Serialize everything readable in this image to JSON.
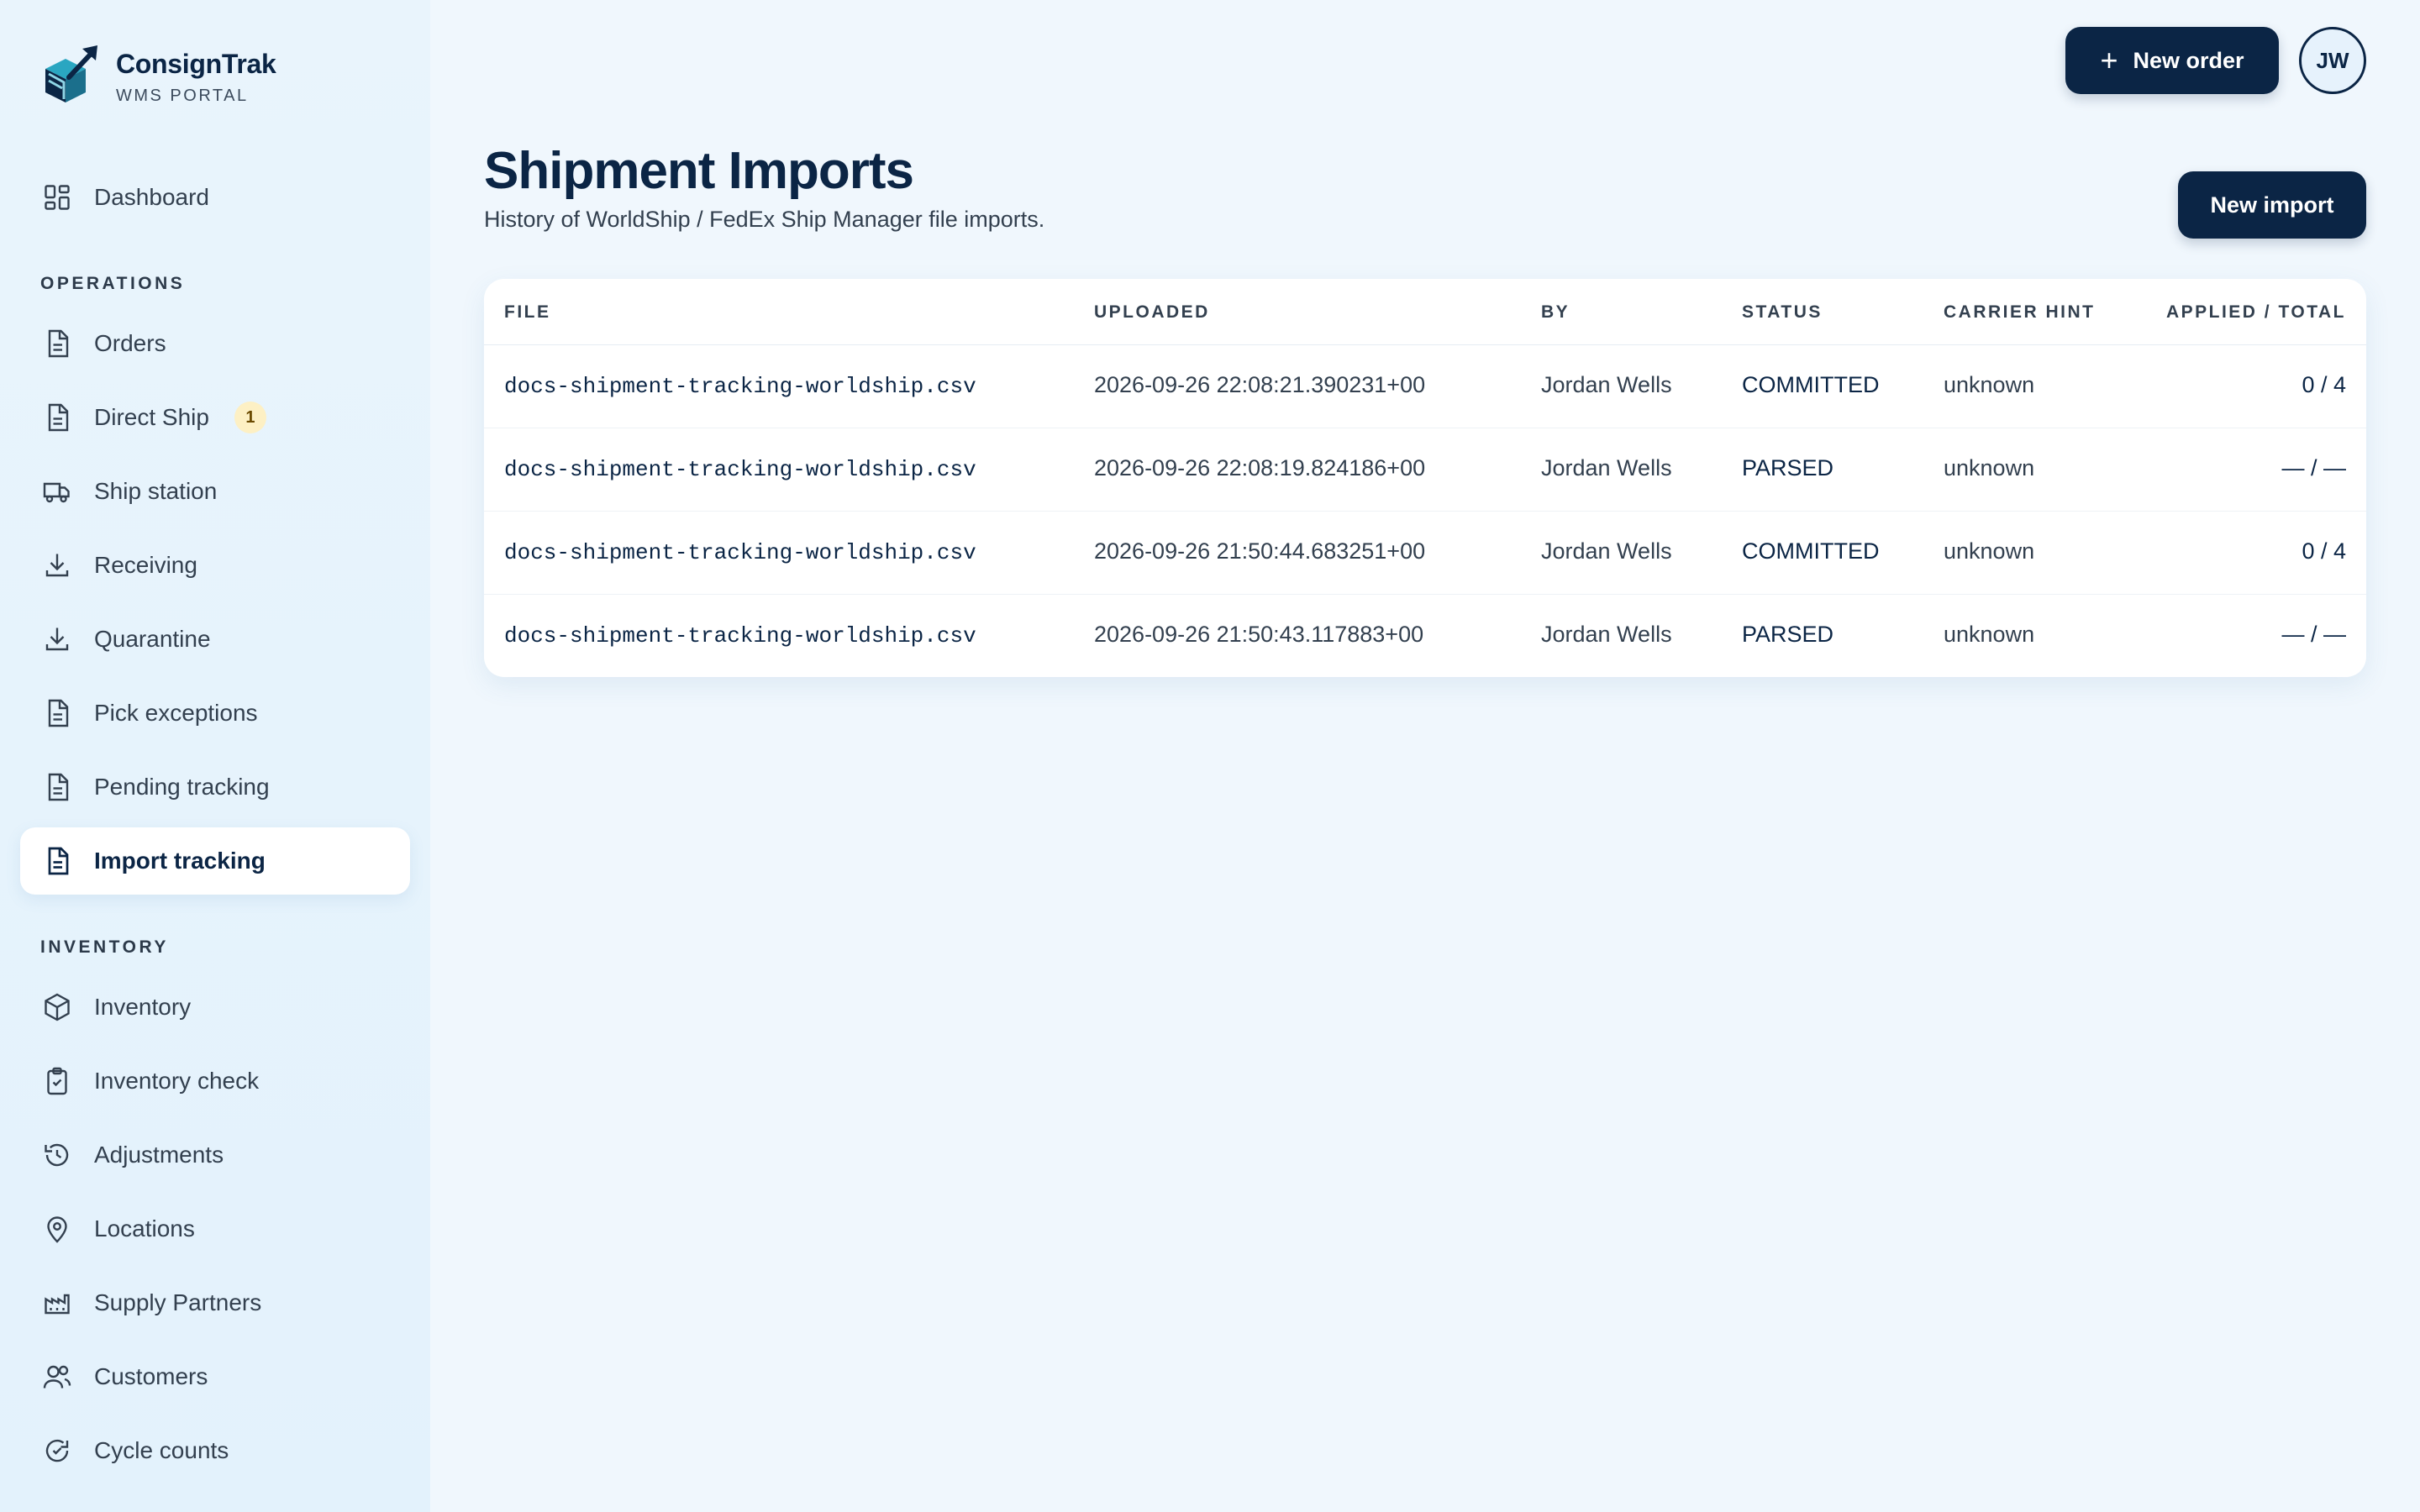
{
  "brand": {
    "name": "ConsignTrak",
    "subtitle": "WMS PORTAL"
  },
  "sidebar": {
    "top_items": [
      {
        "label": "Dashboard",
        "icon": "dashboard-icon"
      }
    ],
    "operations_label": "OPERATIONS",
    "operations": [
      {
        "label": "Orders",
        "icon": "document-icon"
      },
      {
        "label": "Direct Ship",
        "icon": "document-icon",
        "badge": "1"
      },
      {
        "label": "Ship station",
        "icon": "truck-icon"
      },
      {
        "label": "Receiving",
        "icon": "download-icon"
      },
      {
        "label": "Quarantine",
        "icon": "download-icon"
      },
      {
        "label": "Pick exceptions",
        "icon": "document-icon"
      },
      {
        "label": "Pending tracking",
        "icon": "document-icon"
      },
      {
        "label": "Import tracking",
        "icon": "document-icon",
        "active": true
      }
    ],
    "inventory_label": "INVENTORY",
    "inventory": [
      {
        "label": "Inventory",
        "icon": "box-icon"
      },
      {
        "label": "Inventory check",
        "icon": "clipboard-check-icon"
      },
      {
        "label": "Adjustments",
        "icon": "history-icon"
      },
      {
        "label": "Locations",
        "icon": "map-pin-icon"
      },
      {
        "label": "Supply Partners",
        "icon": "factory-icon"
      },
      {
        "label": "Customers",
        "icon": "users-icon"
      },
      {
        "label": "Cycle counts",
        "icon": "refresh-check-icon"
      }
    ]
  },
  "topbar": {
    "new_order_label": "New order",
    "avatar_initials": "JW"
  },
  "page": {
    "title": "Shipment Imports",
    "subtitle": "History of WorldShip / FedEx Ship Manager file imports.",
    "new_import_label": "New import"
  },
  "table": {
    "columns": [
      "FILE",
      "UPLOADED",
      "BY",
      "STATUS",
      "CARRIER HINT",
      "APPLIED / TOTAL"
    ],
    "rows": [
      {
        "file": "docs-shipment-tracking-worldship.csv",
        "uploaded": "2026-09-26 22:08:21.390231+00",
        "by": "Jordan Wells",
        "status": "COMMITTED",
        "carrier": "unknown",
        "applied": "0 / 4"
      },
      {
        "file": "docs-shipment-tracking-worldship.csv",
        "uploaded": "2026-09-26 22:08:19.824186+00",
        "by": "Jordan Wells",
        "status": "PARSED",
        "carrier": "unknown",
        "applied": "— / —"
      },
      {
        "file": "docs-shipment-tracking-worldship.csv",
        "uploaded": "2026-09-26 21:50:44.683251+00",
        "by": "Jordan Wells",
        "status": "COMMITTED",
        "carrier": "unknown",
        "applied": "0 / 4"
      },
      {
        "file": "docs-shipment-tracking-worldship.csv",
        "uploaded": "2026-09-26 21:50:43.117883+00",
        "by": "Jordan Wells",
        "status": "PARSED",
        "carrier": "unknown",
        "applied": "— / —"
      }
    ]
  }
}
